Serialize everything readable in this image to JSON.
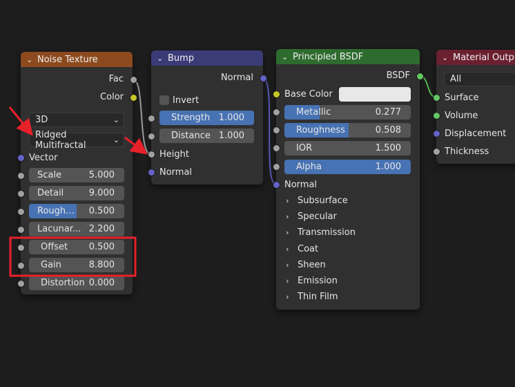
{
  "noise": {
    "title": "Noise Texture",
    "header_color": "#8c4a1e",
    "outputs": [
      "Fac",
      "Color"
    ],
    "dimension": "3D",
    "type": "Ridged Multifractal",
    "vector_label": "Vector",
    "fields": [
      {
        "label": "Scale",
        "value": "5.000",
        "fill": 0
      },
      {
        "label": "Detail",
        "value": "9.000",
        "fill": 0
      },
      {
        "label": "Roughn...",
        "value": "0.500",
        "fill": 0.5
      },
      {
        "label": "Lacunar...",
        "value": "2.200",
        "fill": 0
      },
      {
        "label": "Offset",
        "value": "0.500",
        "fill": 0
      },
      {
        "label": "Gain",
        "value": "8.800",
        "fill": 0
      },
      {
        "label": "Distortion",
        "value": "0.000",
        "fill": 0
      }
    ]
  },
  "bump": {
    "title": "Bump",
    "header_color": "#3b3b78",
    "output": "Normal",
    "invert_label": "Invert",
    "fields": [
      {
        "label": "Strength",
        "value": "1.000",
        "fill": 1
      },
      {
        "label": "Distance",
        "value": "1.000",
        "fill": 0
      }
    ],
    "inputs": [
      "Height",
      "Normal"
    ]
  },
  "bsdf": {
    "title": "Principled BSDF",
    "header_color": "#2e6b2e",
    "output": "BSDF",
    "base_color_label": "Base Color",
    "base_color_value": "#e8e8e8",
    "fields": [
      {
        "label": "Metallic",
        "value": "0.277",
        "fill": 0.277
      },
      {
        "label": "Roughness",
        "value": "0.508",
        "fill": 0.508
      },
      {
        "label": "IOR",
        "value": "1.500",
        "fill": 0
      },
      {
        "label": "Alpha",
        "value": "1.000",
        "fill": 1
      }
    ],
    "normal_label": "Normal",
    "panels": [
      "Subsurface",
      "Specular",
      "Transmission",
      "Coat",
      "Sheen",
      "Emission",
      "Thin Film"
    ]
  },
  "output": {
    "title": "Material Output",
    "header_color": "#6b2030",
    "target": "All",
    "inputs": [
      "Surface",
      "Volume",
      "Displacement",
      "Thickness"
    ]
  },
  "annotation": {
    "arrow_color": "#e8202a",
    "box_color": "#e8202a"
  }
}
